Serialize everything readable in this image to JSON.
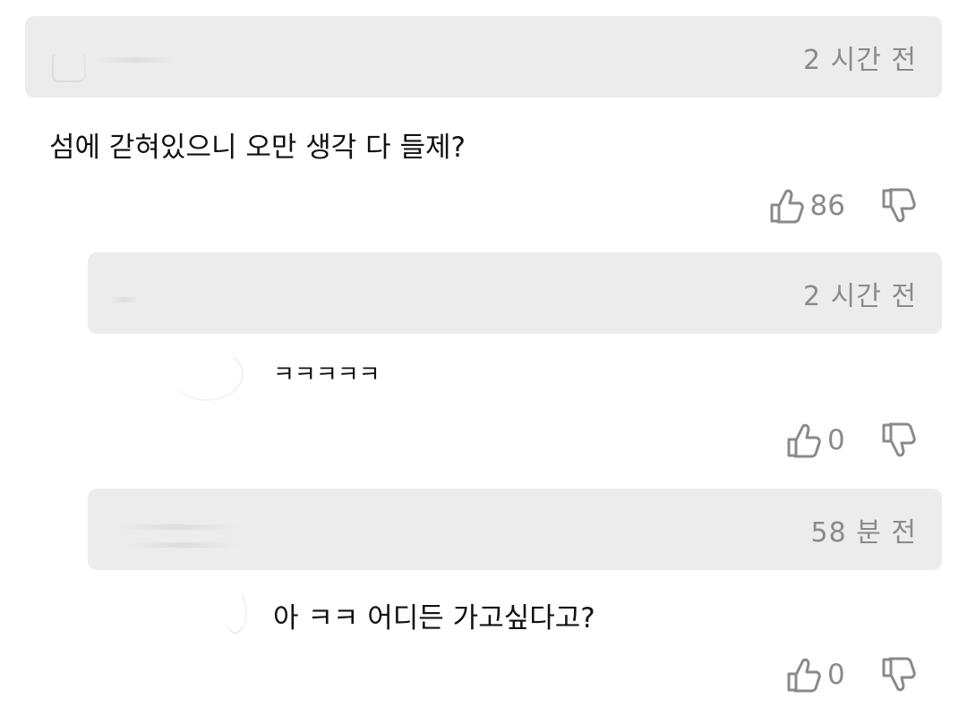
{
  "comments": [
    {
      "timestamp": "2 시간 전",
      "text": "섬에 갇혀있으니 오만 생각 다 들제?",
      "likes": "86"
    },
    {
      "timestamp": "2 시간 전",
      "text": "ㅋㅋㅋㅋㅋ",
      "likes": "0"
    },
    {
      "timestamp": "58 분 전",
      "text": "아 ㅋㅋ 어디든 가고싶다고?",
      "likes": "0"
    }
  ],
  "icons": {
    "like": "thumbs-up-icon",
    "dislike": "thumbs-down-icon"
  }
}
